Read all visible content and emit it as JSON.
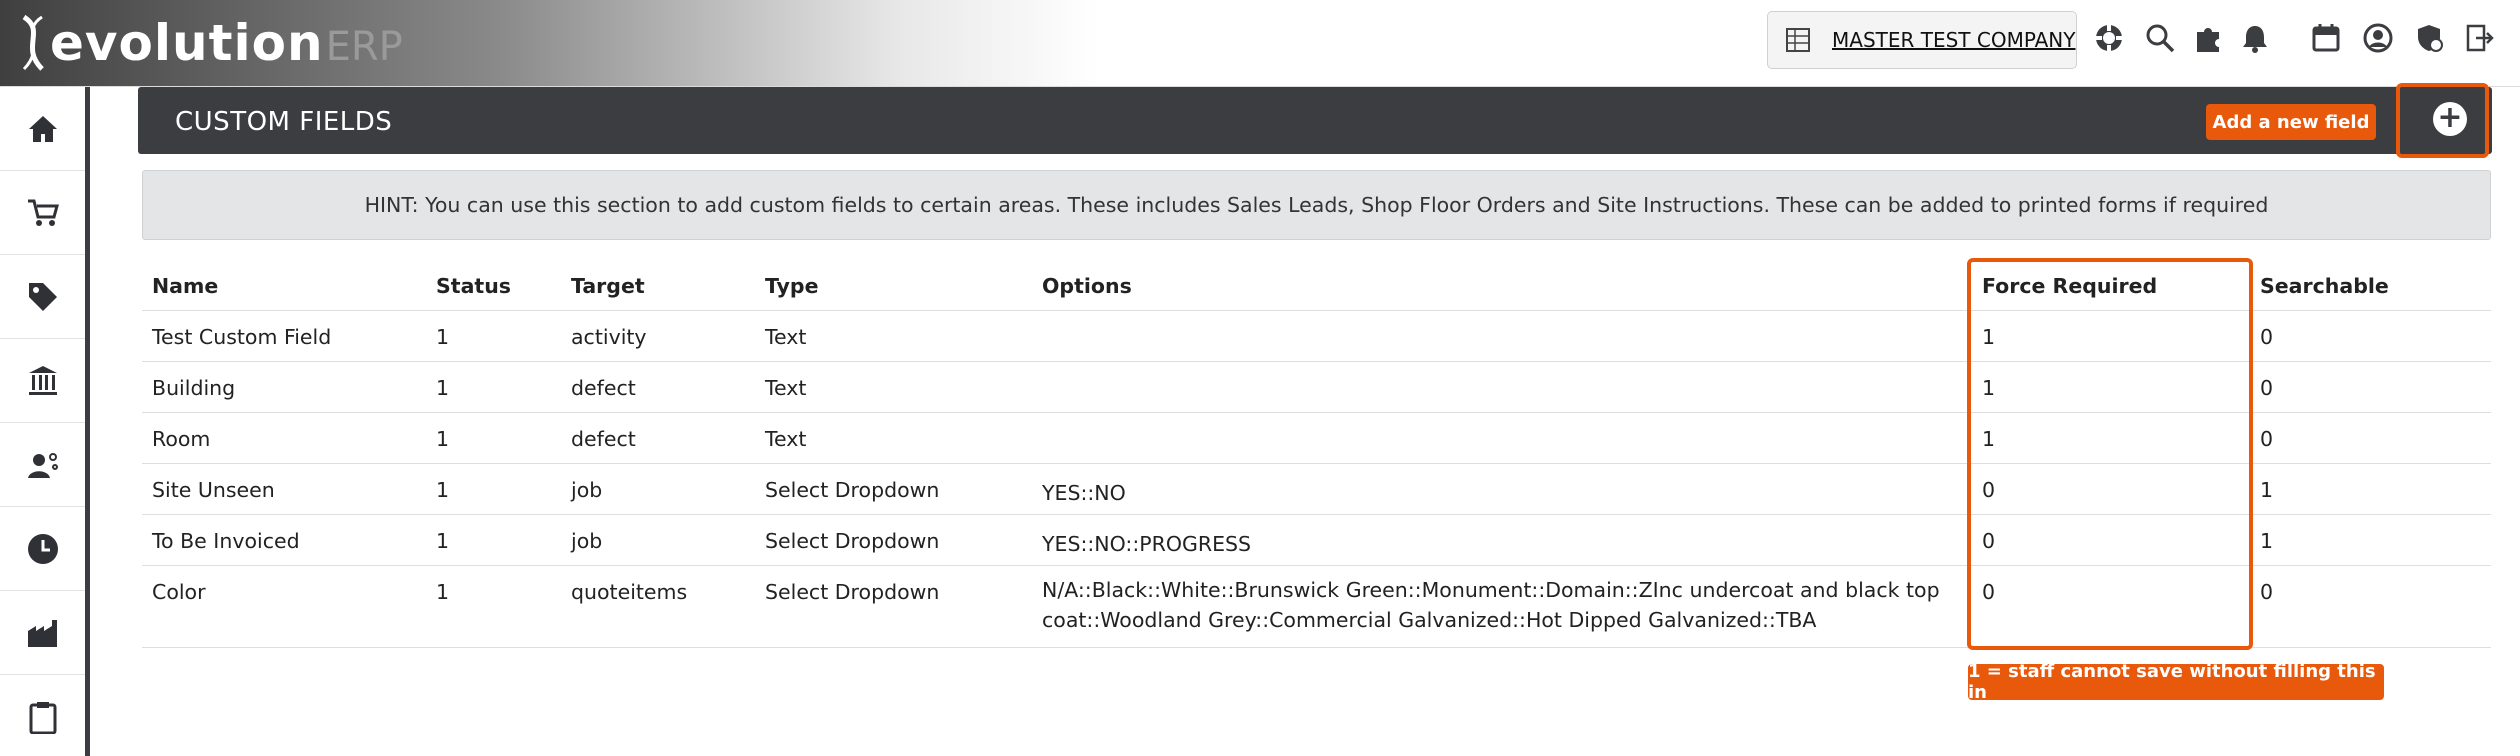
{
  "app": {
    "logo_main": "evolution",
    "logo_suffix": "ERP"
  },
  "topbar": {
    "company_name": "MASTER TEST COMPANY",
    "icons": [
      "building-icon",
      "lifebuoy-icon",
      "search-icon",
      "puzzle-icon",
      "bell-icon",
      "calendar-icon",
      "user-icon",
      "shield-icon",
      "logout-icon"
    ]
  },
  "sidebar": {
    "items": [
      "home-icon",
      "cart-icon",
      "tag-icon",
      "bank-icon",
      "worker-icon",
      "clock-icon",
      "factory-icon",
      "clipboard-icon"
    ]
  },
  "header": {
    "title": "CUSTOM FIELDS",
    "add_button": "Add a new field",
    "plus_symbol": "+"
  },
  "hint": "HINT: You can use this section to add custom fields to certain areas. These includes Sales Leads, Shop Floor Orders and Site Instructions. These can be added to printed forms if required",
  "table": {
    "headers": [
      "Name",
      "Status",
      "Target",
      "Type",
      "Options",
      "Force Required",
      "Searchable"
    ],
    "rows": [
      [
        "Test Custom Field",
        "1",
        "activity",
        "Text",
        "",
        "1",
        "0"
      ],
      [
        "Building",
        "1",
        "defect",
        "Text",
        "",
        "1",
        "0"
      ],
      [
        "Room",
        "1",
        "defect",
        "Text",
        "",
        "1",
        "0"
      ],
      [
        "Site Unseen",
        "1",
        "job",
        "Select Dropdown",
        "YES::NO",
        "0",
        "1"
      ],
      [
        "To Be Invoiced",
        "1",
        "job",
        "Select Dropdown",
        "YES::NO::PROGRESS",
        "0",
        "1"
      ],
      [
        "Color",
        "1",
        "quoteitems",
        "Select Dropdown",
        "N/A::Black::White::Brunswick Green::Monument::Domain::ZInc undercoat and black top coat::Woodland Grey::Commercial Galvanized::Hot Dipped Galvanized::TBA",
        "0",
        "0"
      ]
    ]
  },
  "note": "1 = staff cannot save without filling this in",
  "colors": {
    "accent": "#e8590c",
    "header_bg": "#3b3d41",
    "hint_bg": "#e4e5e6"
  }
}
